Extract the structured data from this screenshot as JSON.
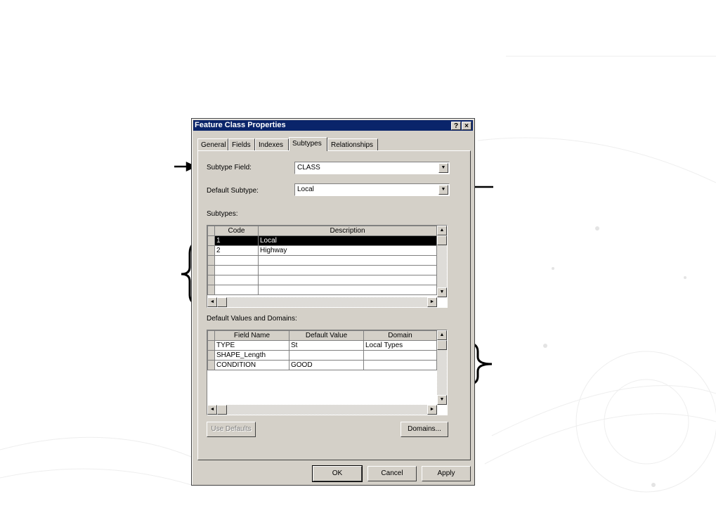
{
  "dialog": {
    "title": "Feature Class Properties",
    "help_btn": "?",
    "close_btn": "×"
  },
  "tabs": [
    {
      "label": "General"
    },
    {
      "label": "Fields"
    },
    {
      "label": "Indexes"
    },
    {
      "label": "Subtypes"
    },
    {
      "label": "Relationships"
    }
  ],
  "active_tab": "Subtypes",
  "subtype_field": {
    "label": "Subtype Field:",
    "value": "CLASS"
  },
  "default_subtype": {
    "label": "Default Subtype:",
    "value": "Local"
  },
  "subtypes": {
    "label": "Subtypes:",
    "columns": [
      "Code",
      "Description"
    ],
    "rows": [
      {
        "code": "1",
        "description": "Local"
      },
      {
        "code": "2",
        "description": "Highway"
      },
      {
        "code": "",
        "description": ""
      },
      {
        "code": "",
        "description": ""
      },
      {
        "code": "",
        "description": ""
      },
      {
        "code": "",
        "description": ""
      }
    ]
  },
  "defaults": {
    "label": "Default Values and Domains:",
    "columns": [
      "Field Name",
      "Default Value",
      "Domain"
    ],
    "rows": [
      {
        "field": "TYPE",
        "default": "St",
        "domain": "Local Types"
      },
      {
        "field": "SHAPE_Length",
        "default": "",
        "domain": ""
      },
      {
        "field": "CONDITION",
        "default": "GOOD",
        "domain": ""
      }
    ]
  },
  "buttons": {
    "use_defaults": "Use Defaults",
    "domains": "Domains...",
    "ok": "OK",
    "cancel": "Cancel",
    "apply": "Apply"
  },
  "icons": {
    "dropdown": "▼",
    "up": "▲",
    "down": "▼",
    "left": "◄",
    "right": "►"
  },
  "colors": {
    "title_bar": "#0a246a",
    "dialog_face": "#d4d0c8",
    "selected_row": "#000000"
  }
}
